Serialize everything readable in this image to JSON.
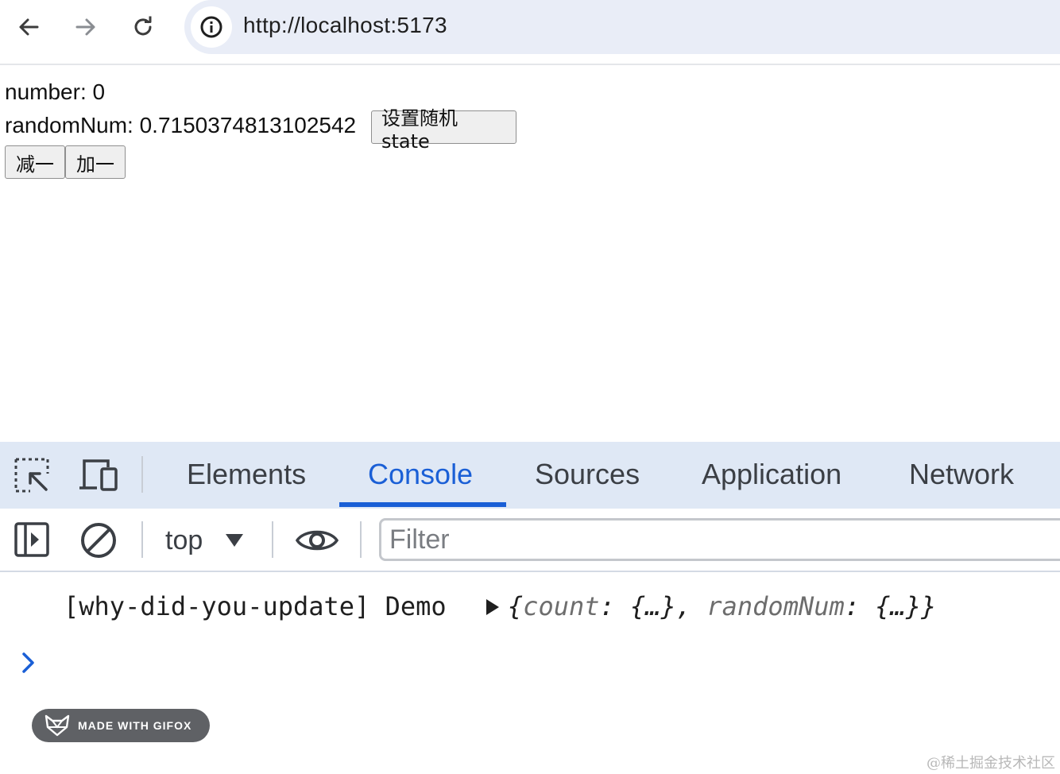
{
  "browser": {
    "url": "http://localhost:5173"
  },
  "page": {
    "number_text": "number: 0",
    "random_text": "randomNum: 0.7150374813102542",
    "set_random_button": "设置随机 state",
    "decrement_button": "减一",
    "increment_button": "加一"
  },
  "devtools": {
    "tabs": [
      {
        "label": "Elements",
        "active": false
      },
      {
        "label": "Console",
        "active": true
      },
      {
        "label": "Sources",
        "active": false
      },
      {
        "label": "Application",
        "active": false
      },
      {
        "label": "Network",
        "active": false
      }
    ],
    "context_label": "top",
    "filter_placeholder": "Filter",
    "log": {
      "prefix": "[why-did-you-update] Demo",
      "obj_open": "{",
      "key1": "count",
      "val1": ": {…}, ",
      "key2": "randomNum",
      "val2": ": {…}",
      "obj_close": "}"
    },
    "accent_color": "#1a5fd6"
  },
  "overlay": {
    "gifox_badge": "MADE WITH GIFOX",
    "watermark": "@稀土掘金技术社区"
  }
}
